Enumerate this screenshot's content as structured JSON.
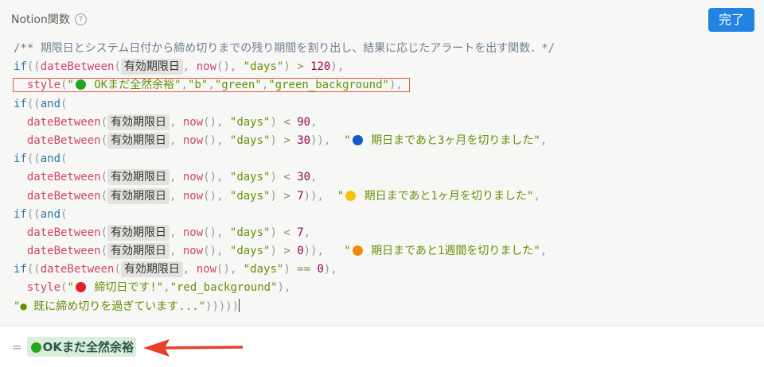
{
  "header": {
    "title": "Notion関数",
    "help_icon": "?",
    "done_label": "完了",
    "done_color": "#2383e2"
  },
  "code": {
    "highlighted_line": 2,
    "lines": [
      [
        {
          "k": "comment",
          "t": "/** 期限日とシステム日付から締め切りまでの残り期間を割り出し、結果に応じたアラートを出す関数．*/"
        }
      ],
      [
        {
          "k": "kw",
          "t": "if"
        },
        {
          "k": "p",
          "t": "(("
        },
        {
          "k": "fn",
          "t": "dateBetween"
        },
        {
          "k": "p",
          "t": "("
        },
        {
          "k": "prop",
          "t": "有効期限日"
        },
        {
          "k": "p",
          "t": ", "
        },
        {
          "k": "fn",
          "t": "now"
        },
        {
          "k": "p",
          "t": "(), "
        },
        {
          "k": "str",
          "t": "\"days\""
        },
        {
          "k": "p",
          "t": ") "
        },
        {
          "k": "op",
          "t": ">"
        },
        {
          "k": "p",
          "t": " "
        },
        {
          "k": "num",
          "t": "120"
        },
        {
          "k": "p",
          "t": "),"
        }
      ],
      [
        {
          "k": "p",
          "t": "  "
        },
        {
          "k": "fn",
          "t": "style"
        },
        {
          "k": "p",
          "t": "("
        },
        {
          "k": "str",
          "t": "\""
        },
        {
          "k": "dot",
          "c": "#1fa81f"
        },
        {
          "k": "str",
          "t": " OKまだ全然余裕\""
        },
        {
          "k": "p",
          "t": ","
        },
        {
          "k": "str",
          "t": "\"b\""
        },
        {
          "k": "p",
          "t": ","
        },
        {
          "k": "str",
          "t": "\"green\""
        },
        {
          "k": "p",
          "t": ","
        },
        {
          "k": "str",
          "t": "\"green_background\""
        },
        {
          "k": "p",
          "t": "),"
        }
      ],
      [
        {
          "k": "kw",
          "t": "if"
        },
        {
          "k": "p",
          "t": "(("
        },
        {
          "k": "kw",
          "t": "and"
        },
        {
          "k": "p",
          "t": "("
        }
      ],
      [
        {
          "k": "p",
          "t": "  "
        },
        {
          "k": "fn",
          "t": "dateBetween"
        },
        {
          "k": "p",
          "t": "("
        },
        {
          "k": "prop",
          "t": "有効期限日"
        },
        {
          "k": "p",
          "t": ", "
        },
        {
          "k": "fn",
          "t": "now"
        },
        {
          "k": "p",
          "t": "(), "
        },
        {
          "k": "str",
          "t": "\"days\""
        },
        {
          "k": "p",
          "t": ") "
        },
        {
          "k": "op",
          "t": "<"
        },
        {
          "k": "p",
          "t": " "
        },
        {
          "k": "num",
          "t": "90"
        },
        {
          "k": "p",
          "t": ","
        }
      ],
      [
        {
          "k": "p",
          "t": "  "
        },
        {
          "k": "fn",
          "t": "dateBetween"
        },
        {
          "k": "p",
          "t": "("
        },
        {
          "k": "prop",
          "t": "有効期限日"
        },
        {
          "k": "p",
          "t": ", "
        },
        {
          "k": "fn",
          "t": "now"
        },
        {
          "k": "p",
          "t": "(), "
        },
        {
          "k": "str",
          "t": "\"days\""
        },
        {
          "k": "p",
          "t": ") "
        },
        {
          "k": "op",
          "t": ">"
        },
        {
          "k": "p",
          "t": " "
        },
        {
          "k": "num",
          "t": "30"
        },
        {
          "k": "p",
          "t": ")),  "
        },
        {
          "k": "str",
          "t": "\""
        },
        {
          "k": "dot",
          "c": "#1558c9"
        },
        {
          "k": "str",
          "t": " 期日まであと3ヶ月を切りました\""
        },
        {
          "k": "p",
          "t": ","
        }
      ],
      [
        {
          "k": "kw",
          "t": "if"
        },
        {
          "k": "p",
          "t": "(("
        },
        {
          "k": "kw",
          "t": "and"
        },
        {
          "k": "p",
          "t": "("
        }
      ],
      [
        {
          "k": "p",
          "t": "  "
        },
        {
          "k": "fn",
          "t": "dateBetween"
        },
        {
          "k": "p",
          "t": "("
        },
        {
          "k": "prop",
          "t": "有効期限日"
        },
        {
          "k": "p",
          "t": ", "
        },
        {
          "k": "fn",
          "t": "now"
        },
        {
          "k": "p",
          "t": "(), "
        },
        {
          "k": "str",
          "t": "\"days\""
        },
        {
          "k": "p",
          "t": ") "
        },
        {
          "k": "op",
          "t": "<"
        },
        {
          "k": "p",
          "t": " "
        },
        {
          "k": "num",
          "t": "30"
        },
        {
          "k": "p",
          "t": ","
        }
      ],
      [
        {
          "k": "p",
          "t": "  "
        },
        {
          "k": "fn",
          "t": "dateBetween"
        },
        {
          "k": "p",
          "t": "("
        },
        {
          "k": "prop",
          "t": "有効期限日"
        },
        {
          "k": "p",
          "t": ", "
        },
        {
          "k": "fn",
          "t": "now"
        },
        {
          "k": "p",
          "t": "(), "
        },
        {
          "k": "str",
          "t": "\"days\""
        },
        {
          "k": "p",
          "t": ") "
        },
        {
          "k": "op",
          "t": ">"
        },
        {
          "k": "p",
          "t": " "
        },
        {
          "k": "num",
          "t": "7"
        },
        {
          "k": "p",
          "t": ")),  "
        },
        {
          "k": "str",
          "t": "\""
        },
        {
          "k": "dot",
          "c": "#f5c400"
        },
        {
          "k": "str",
          "t": " 期日まであと1ヶ月を切りました\""
        },
        {
          "k": "p",
          "t": ","
        }
      ],
      [
        {
          "k": "kw",
          "t": "if"
        },
        {
          "k": "p",
          "t": "(("
        },
        {
          "k": "kw",
          "t": "and"
        },
        {
          "k": "p",
          "t": "("
        }
      ],
      [
        {
          "k": "p",
          "t": "  "
        },
        {
          "k": "fn",
          "t": "dateBetween"
        },
        {
          "k": "p",
          "t": "("
        },
        {
          "k": "prop",
          "t": "有効期限日"
        },
        {
          "k": "p",
          "t": ", "
        },
        {
          "k": "fn",
          "t": "now"
        },
        {
          "k": "p",
          "t": "(), "
        },
        {
          "k": "str",
          "t": "\"days\""
        },
        {
          "k": "p",
          "t": ") "
        },
        {
          "k": "op",
          "t": "<"
        },
        {
          "k": "p",
          "t": " "
        },
        {
          "k": "num",
          "t": "7"
        },
        {
          "k": "p",
          "t": ","
        }
      ],
      [
        {
          "k": "p",
          "t": "  "
        },
        {
          "k": "fn",
          "t": "dateBetween"
        },
        {
          "k": "p",
          "t": "("
        },
        {
          "k": "prop",
          "t": "有効期限日"
        },
        {
          "k": "p",
          "t": ", "
        },
        {
          "k": "fn",
          "t": "now"
        },
        {
          "k": "p",
          "t": "(), "
        },
        {
          "k": "str",
          "t": "\"days\""
        },
        {
          "k": "p",
          "t": ") "
        },
        {
          "k": "op",
          "t": ">"
        },
        {
          "k": "p",
          "t": " "
        },
        {
          "k": "num",
          "t": "0"
        },
        {
          "k": "p",
          "t": ")),   "
        },
        {
          "k": "str",
          "t": "\""
        },
        {
          "k": "dot",
          "c": "#f08a12"
        },
        {
          "k": "str",
          "t": " 期日まであと1週間を切りました\""
        },
        {
          "k": "p",
          "t": ","
        }
      ],
      [
        {
          "k": "kw",
          "t": "if"
        },
        {
          "k": "p",
          "t": "(("
        },
        {
          "k": "fn",
          "t": "dateBetween"
        },
        {
          "k": "p",
          "t": "("
        },
        {
          "k": "prop",
          "t": "有効期限日"
        },
        {
          "k": "p",
          "t": ", "
        },
        {
          "k": "fn",
          "t": "now"
        },
        {
          "k": "p",
          "t": "(), "
        },
        {
          "k": "str",
          "t": "\"days\""
        },
        {
          "k": "p",
          "t": ") "
        },
        {
          "k": "op",
          "t": "=="
        },
        {
          "k": "p",
          "t": " "
        },
        {
          "k": "num",
          "t": "0"
        },
        {
          "k": "p",
          "t": "),"
        }
      ],
      [
        {
          "k": "p",
          "t": "  "
        },
        {
          "k": "fn",
          "t": "style"
        },
        {
          "k": "p",
          "t": "("
        },
        {
          "k": "str",
          "t": "\""
        },
        {
          "k": "dot",
          "c": "#e0202a"
        },
        {
          "k": "str",
          "t": " 締切日です!\""
        },
        {
          "k": "p",
          "t": ","
        },
        {
          "k": "str",
          "t": "\"red_background\""
        },
        {
          "k": "p",
          "t": "),"
        }
      ],
      [
        {
          "k": "str",
          "t": "\"● 既に締め切りを過ぎています...\""
        },
        {
          "k": "p",
          "t": ")))))"
        },
        {
          "k": "cursor"
        }
      ]
    ]
  },
  "result": {
    "equals": "=",
    "text": "OKまだ全然余裕",
    "dot_color": "#1fa81f",
    "bg": "#dbeddb"
  },
  "annotation": {
    "arrow_color": "#e8402a",
    "box_color": "#e8563f"
  }
}
